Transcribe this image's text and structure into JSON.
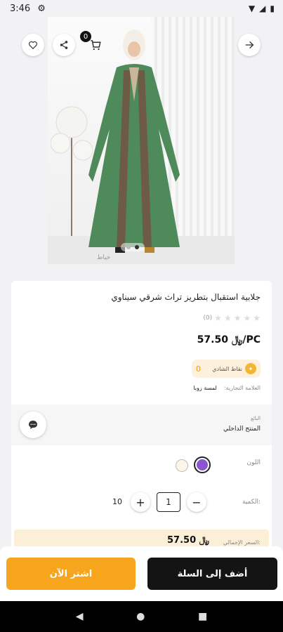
{
  "status_bar": {
    "time": "3:46"
  },
  "hero": {
    "cart_count": "0",
    "image_credit": "خياط",
    "dots_total": 2,
    "dots_active": 1
  },
  "product": {
    "title": "جلابية استقبال بتطريز تراث شرقي سيناوي",
    "rating_count": "(0)",
    "price": "57.50 ﷼/PC",
    "points_label": "نقاط الشادي",
    "points_value": "0",
    "brand_label": "العلامة التجارية:",
    "brand_value": "لمسة زوبا"
  },
  "seller": {
    "label": "البائع",
    "value": "المنتج الداخلي"
  },
  "options": {
    "color_label": "اللون",
    "quantity_label": "الكمية:",
    "quantity_value": "1",
    "stock": "10",
    "colors": [
      "#8a55cf",
      "#fbf6e9"
    ]
  },
  "total": {
    "label": "السعر الإجمالي:",
    "value": "57.50 ﷼"
  },
  "actions": {
    "add_to_cart": "أضف إلى السلة",
    "buy_now": "اشتر الآن"
  },
  "colors": {
    "buy_now": "#f7a51c",
    "add_to_cart": "#141414",
    "accent_purple": "#8a55cf"
  }
}
